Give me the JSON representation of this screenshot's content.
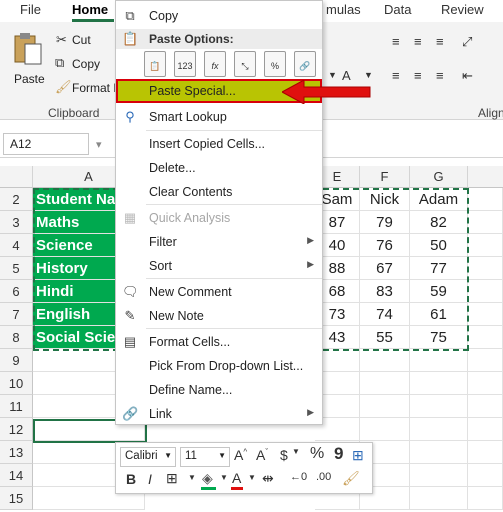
{
  "ribbon": {
    "tabs": [
      "File",
      "Home",
      "mulas",
      "Data",
      "Review"
    ],
    "active_tab": "Home",
    "paste_label": "Paste",
    "cut_label": "Cut",
    "copy_label": "Copy",
    "format_painter_label": "Format P",
    "clipboard_group": "Clipboard",
    "align_group": "Align"
  },
  "formula_bar": {
    "name_box": "A12"
  },
  "sheet": {
    "columns": [
      "A",
      "E",
      "F",
      "G"
    ],
    "rows": [
      "2",
      "3",
      "4",
      "5",
      "6",
      "7",
      "8",
      "9",
      "10",
      "11",
      "12",
      "13",
      "14",
      "15"
    ],
    "subject_cells": [
      "Student Na",
      "Maths",
      "Science",
      "History",
      "Hindi",
      "English",
      "Social Scier"
    ],
    "table_rows": [
      [
        "Sam",
        "Nick",
        "Adam"
      ],
      [
        "87",
        "79",
        "82"
      ],
      [
        "40",
        "76",
        "50"
      ],
      [
        "88",
        "67",
        "77"
      ],
      [
        "68",
        "83",
        "59"
      ],
      [
        "73",
        "74",
        "61"
      ],
      [
        "43",
        "55",
        "75"
      ]
    ]
  },
  "context_menu": {
    "copy": "Copy",
    "paste_options": "Paste Options:",
    "paste_special": "Paste Special...",
    "smart_lookup": "Smart Lookup",
    "insert_copied": "Insert Copied Cells...",
    "delete": "Delete...",
    "clear_contents": "Clear Contents",
    "quick_analysis": "Quick Analysis",
    "filter": "Filter",
    "sort": "Sort",
    "new_comment": "New Comment",
    "new_note": "New Note",
    "format_cells": "Format Cells...",
    "pick_from_list": "Pick From Drop-down List...",
    "define_name": "Define Name...",
    "link": "Link",
    "paste_icon_123": "123"
  },
  "mini_toolbar": {
    "font": "Calibri",
    "size": "11",
    "bold": "B",
    "italic": "I",
    "currency": "$",
    "percent": "%",
    "comma": "9"
  },
  "colors": {
    "excel_green": "#217346",
    "cell_green": "#00a94f",
    "highlight": "#b9c403",
    "arrow_red": "#e0100f"
  }
}
